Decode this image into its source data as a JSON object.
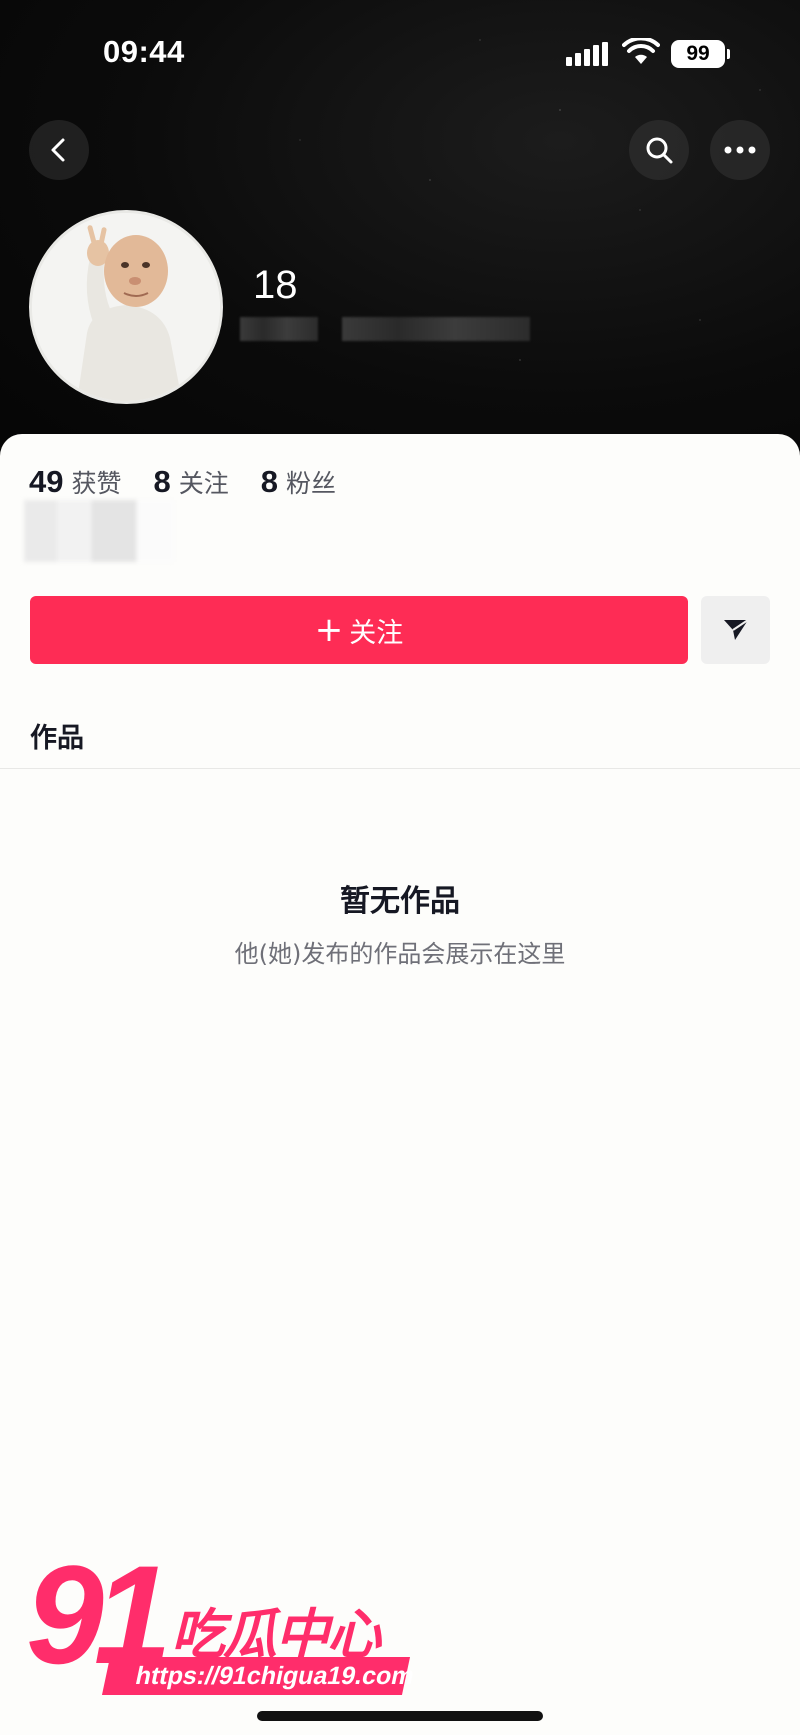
{
  "status_bar": {
    "time": "09:44",
    "battery": "99"
  },
  "header": {
    "nickname": "18",
    "buttons": {
      "back": "back-icon",
      "search": "search-icon",
      "more": "more-icon"
    }
  },
  "stats": [
    {
      "value": "49",
      "label": "获赞"
    },
    {
      "value": "8",
      "label": "关注"
    },
    {
      "value": "8",
      "label": "粉丝"
    }
  ],
  "actions": {
    "follow_plus": "+",
    "follow_label": "关注",
    "share_icon": "send-icon",
    "accent_color": "#fe2c55"
  },
  "tabs": {
    "works": "作品"
  },
  "empty_state": {
    "title": "暂无作品",
    "description": "他(她)发布的作品会展示在这里"
  },
  "watermark": {
    "number": "91",
    "brand": "吃瓜中心",
    "url": "https://91chigua19.com"
  }
}
